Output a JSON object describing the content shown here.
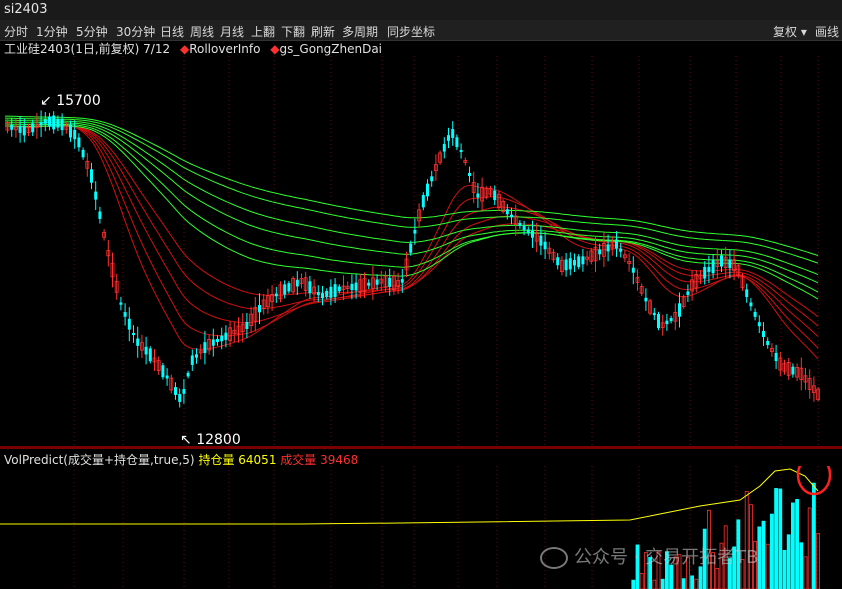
{
  "window": {
    "title": "si2403"
  },
  "toolbar": {
    "items": [
      "分时",
      "1分钟",
      "5分钟",
      "30分钟",
      "日线",
      "周线",
      "月线",
      "上翻",
      "下翻",
      "刷新",
      "多周期",
      "同步坐标"
    ],
    "right": [
      "复权",
      "画线"
    ]
  },
  "main": {
    "contract": "工业硅2403(1日,前复权) 7/12",
    "ind1": "RolloverInfo",
    "ind2": "gs_GongZhenDai",
    "high_label": "15700",
    "low_label": "12800"
  },
  "volume": {
    "formula": "VolPredict(成交量+持仓量,true,5)",
    "oi_label": "持仓量",
    "oi_value": "64051",
    "vol_label": "成交量",
    "vol_value": "39468"
  },
  "watermark": {
    "text": "公众号 · 交易开拓者TB"
  },
  "colors": {
    "up": "#ff3030",
    "down": "#00ffff",
    "grid": "#7a0000",
    "ma_red": "#d01010",
    "ma_green": "#30ff30",
    "oi_line": "#ffff00"
  }
}
